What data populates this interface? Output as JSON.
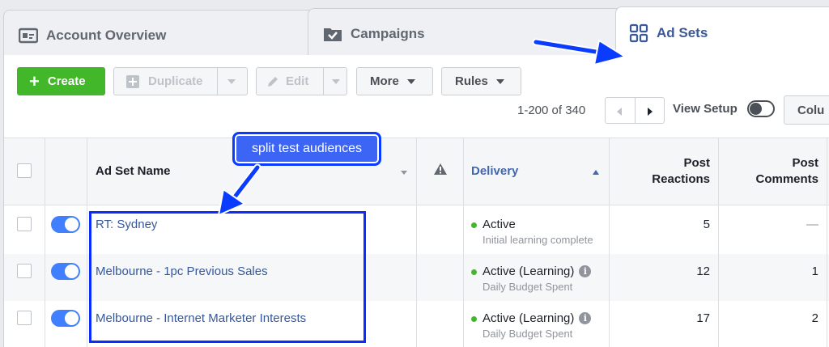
{
  "tabs": {
    "account": "Account Overview",
    "campaigns": "Campaigns",
    "adsets": "Ad Sets"
  },
  "toolbar": {
    "create": "Create",
    "duplicate": "Duplicate",
    "edit": "Edit",
    "more": "More",
    "rules": "Rules",
    "range": "1-200 of 340",
    "view_setup": "View Setup",
    "columns": "Colu"
  },
  "table": {
    "headers": {
      "name": "Ad Set Name",
      "delivery": "Delivery",
      "reactions_1": "Post",
      "reactions_2": "Reactions",
      "comments_1": "Post",
      "comments_2": "Comments"
    },
    "rows": [
      {
        "name": "RT: Sydney",
        "status": "Active",
        "sub": "Initial learning complete",
        "reactions": "5",
        "comments": "—"
      },
      {
        "name": "Melbourne - 1pc Previous Sales",
        "status": "Active (Learning)",
        "sub": "Daily Budget Spent",
        "reactions": "12",
        "comments": "1"
      },
      {
        "name": "Melbourne - Internet Marketer Interests",
        "status": "Active (Learning)",
        "sub": "Daily Budget Spent",
        "reactions": "17",
        "comments": "2"
      }
    ]
  },
  "annotation": {
    "callout": "split test audiences"
  },
  "colors": {
    "accent": "#3b5998",
    "link": "#365899",
    "create": "#42b72a",
    "annotation": "#0a3cff"
  }
}
